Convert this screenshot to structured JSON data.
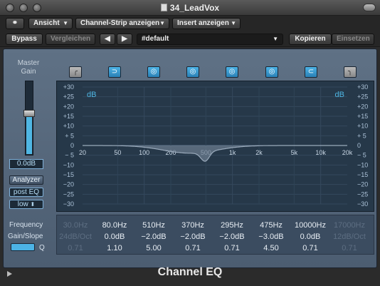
{
  "window": {
    "title": "34_LeadVox"
  },
  "toolbar": {
    "link_icon": "link-icon",
    "view_menu": "Ansicht",
    "channel_strip_menu": "Channel-Strip anzeigen",
    "insert_menu": "Insert anzeigen",
    "bypass": "Bypass",
    "compare": "Vergleichen",
    "prev_icon": "triangle-left-icon",
    "next_icon": "triangle-right-icon",
    "preset": "#default",
    "copy": "Kopieren",
    "paste": "Einsetzen"
  },
  "plugin": {
    "name": "Channel EQ",
    "master_gain_label": "Master Gain",
    "master_gain_value": "0.0dB",
    "master_gain_level": 0.56,
    "analyzer_button": "Analyzer",
    "analyzer_mode": "post EQ",
    "analyzer_resolution": "low",
    "db_unit": "dB",
    "db_scale": [
      "+30",
      "+25",
      "+20",
      "+15",
      "+10",
      "+ 5",
      "0",
      "− 5",
      "−10",
      "−15",
      "−20",
      "−25",
      "−30"
    ],
    "freq_labels": [
      "20",
      "50",
      "100",
      "200",
      "500",
      "1k",
      "2k",
      "5k",
      "10k",
      "20k"
    ],
    "row_labels": {
      "frequency": "Frequency",
      "gain_slope": "Gain/Slope",
      "q": "Q"
    },
    "bands": [
      {
        "icon": "low-cut-icon",
        "on": false,
        "freq": "30.0Hz",
        "gain": "24dB/Oct",
        "q": "0.71"
      },
      {
        "icon": "low-shelf-icon",
        "on": true,
        "freq": "80.0Hz",
        "gain": "0.0dB",
        "q": "1.10"
      },
      {
        "icon": "bell-icon",
        "on": true,
        "freq": "510Hz",
        "gain": "−2.0dB",
        "q": "5.00"
      },
      {
        "icon": "bell-icon",
        "on": true,
        "freq": "370Hz",
        "gain": "−2.0dB",
        "q": "0.71"
      },
      {
        "icon": "bell-icon",
        "on": true,
        "freq": "295Hz",
        "gain": "−2.0dB",
        "q": "0.71"
      },
      {
        "icon": "bell-icon",
        "on": true,
        "freq": "475Hz",
        "gain": "−3.0dB",
        "q": "4.50"
      },
      {
        "icon": "high-shelf-icon",
        "on": true,
        "freq": "10000Hz",
        "gain": "0.0dB",
        "q": "0.71"
      },
      {
        "icon": "high-cut-icon",
        "on": false,
        "freq": "17000Hz",
        "gain": "12dB/Oct",
        "q": "0.71"
      }
    ]
  }
}
